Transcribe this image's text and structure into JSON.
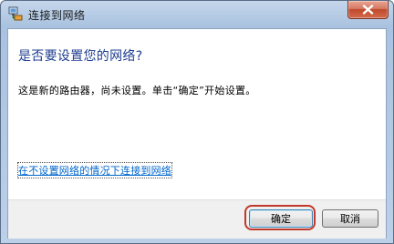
{
  "window": {
    "title": "连接到网络",
    "icon": "network-icon"
  },
  "dialog": {
    "heading": "是否要设置您的网络?",
    "message": "这是新的路由器，尚未设置。单击“确定”开始设置。",
    "link": "在不设置网络的情况下连接到网络"
  },
  "buttons": {
    "ok_label": "确定",
    "cancel_label": "取消"
  },
  "colors": {
    "heading": "#1e3d8f",
    "link": "#0066cc",
    "highlight_ring": "#c0392b",
    "close_button": "#c04a2b"
  }
}
